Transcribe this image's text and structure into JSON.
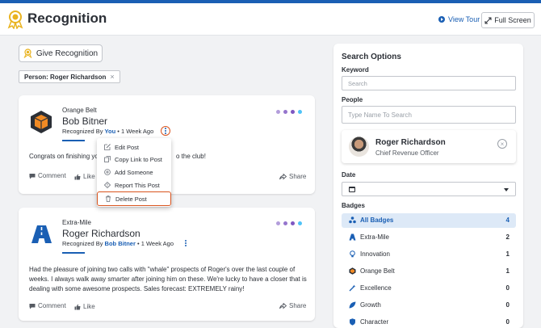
{
  "header": {
    "title": "Recognition",
    "view_tour": "View Tour",
    "full_screen": "Full Screen"
  },
  "toolbar": {
    "give_label": "Give Recognition",
    "filter_chip": "Person: Roger Richardson",
    "filter_chip_close": "×"
  },
  "colors": {
    "brand_blue": "#1a5fb4",
    "highlight_orange": "#d9541e",
    "dot_colors": [
      "#b39ddb",
      "#9575cd",
      "#7e57c2",
      "#4fc3f7"
    ]
  },
  "posts": [
    {
      "badge": "Orange Belt",
      "badge_icon": "orange-cube-icon",
      "person": "Bob Bitner",
      "recognized_by_prefix": "Recognized By",
      "recognized_by": "You",
      "time": "• 1 Week Ago",
      "message": "Congrats on finishing yo",
      "message_tail": "o the club!",
      "comment": "Comment",
      "like": "Like",
      "share": "Share"
    },
    {
      "badge": "Extra-Mile",
      "badge_icon": "road-icon",
      "person": "Roger Richardson",
      "recognized_by_prefix": "Recognized By",
      "recognized_by": "Bob Bitner",
      "time": "• 1 Week Ago",
      "message_lines": [
        "Had the pleasure of joining two calls with \"whale\" prospects of Roger's over the last couple of",
        "weeks. I always walk away smarter after joining him on these. We're lucky to have a closer that is",
        "dealing with some awesome prospects. Sales forecast: EXTREMELY rainy!"
      ],
      "comment": "Comment",
      "like": "Like",
      "share": "Share"
    }
  ],
  "context_menu": {
    "items": [
      {
        "label": "Edit Post",
        "icon": "edit-icon"
      },
      {
        "label": "Copy Link to Post",
        "icon": "copy-icon"
      },
      {
        "label": "Add Someone",
        "icon": "add-circle-icon"
      },
      {
        "label": "Report This Post",
        "icon": "report-icon"
      },
      {
        "label": "Delete Post",
        "icon": "trash-icon"
      }
    ]
  },
  "search": {
    "title": "Search Options",
    "keyword_label": "Keyword",
    "keyword_placeholder": "Search",
    "people_label": "People",
    "people_placeholder": "Type Name To Search",
    "selected_person": {
      "name": "Roger Richardson",
      "role": "Chief Revenue Officer",
      "remove": "×"
    },
    "date_label": "Date",
    "badges_label": "Badges",
    "badges": [
      {
        "label": "All Badges",
        "count": "4",
        "icon": "all-badges-icon"
      },
      {
        "label": "Extra-Mile",
        "count": "2",
        "icon": "road-icon"
      },
      {
        "label": "Innovation",
        "count": "1",
        "icon": "lightbulb-icon"
      },
      {
        "label": "Orange Belt",
        "count": "1",
        "icon": "orange-cube-icon"
      },
      {
        "label": "Excellence",
        "count": "0",
        "icon": "wand-icon"
      },
      {
        "label": "Growth",
        "count": "0",
        "icon": "leaf-icon"
      },
      {
        "label": "Character",
        "count": "0",
        "icon": "shield-icon"
      }
    ]
  }
}
